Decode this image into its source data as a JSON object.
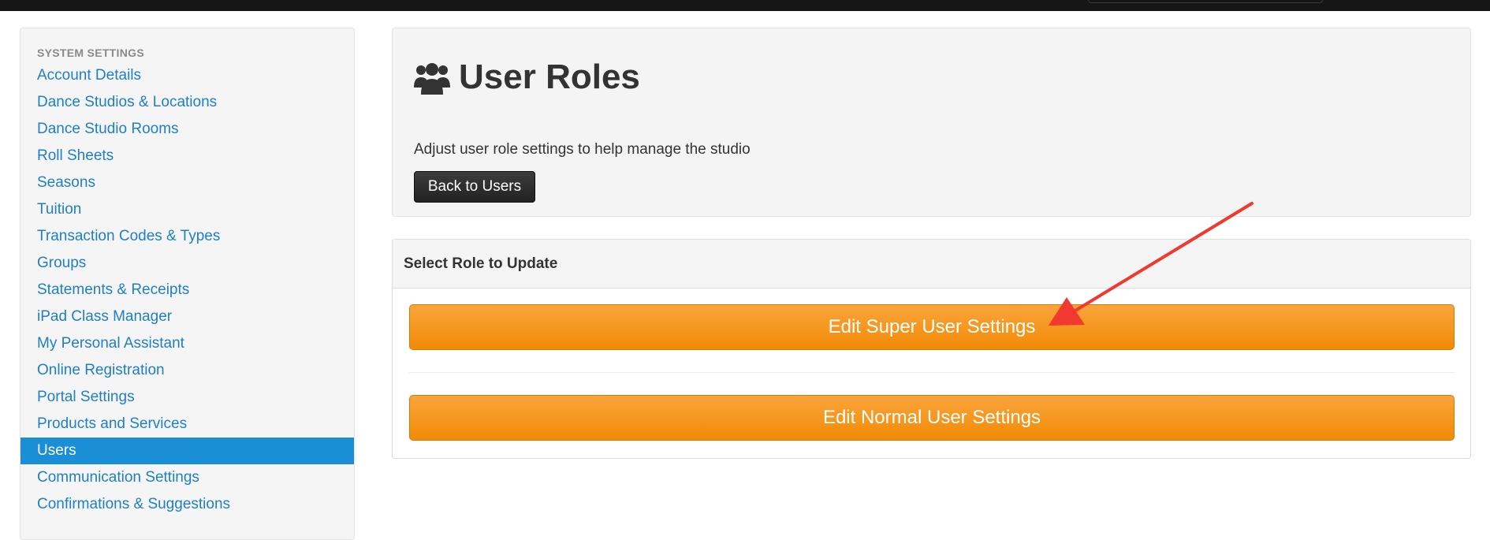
{
  "sidebar": {
    "header": "SYSTEM SETTINGS",
    "items": [
      {
        "label": "Account Details"
      },
      {
        "label": "Dance Studios & Locations"
      },
      {
        "label": "Dance Studio Rooms"
      },
      {
        "label": "Roll Sheets"
      },
      {
        "label": "Seasons"
      },
      {
        "label": "Tuition"
      },
      {
        "label": "Transaction Codes & Types"
      },
      {
        "label": "Groups"
      },
      {
        "label": "Statements & Receipts"
      },
      {
        "label": "iPad Class Manager"
      },
      {
        "label": "My Personal Assistant"
      },
      {
        "label": "Online Registration"
      },
      {
        "label": "Portal Settings"
      },
      {
        "label": "Products and Services"
      },
      {
        "label": "Users",
        "active": true
      },
      {
        "label": "Communication Settings"
      },
      {
        "label": "Confirmations & Suggestions"
      }
    ]
  },
  "page": {
    "icon": "users-icon",
    "title": "User Roles",
    "subtitle": "Adjust user role settings to help manage the studio",
    "back_button_label": "Back to Users"
  },
  "roles_panel": {
    "heading": "Select Role to Update",
    "super_button_label": "Edit Super User Settings",
    "normal_button_label": "Edit Normal User Settings"
  },
  "colors": {
    "link": "#1f7fc4",
    "active_item": "#1a8fd6",
    "orange_button": "#f28a06",
    "annotation_arrow": "#f2392f"
  }
}
